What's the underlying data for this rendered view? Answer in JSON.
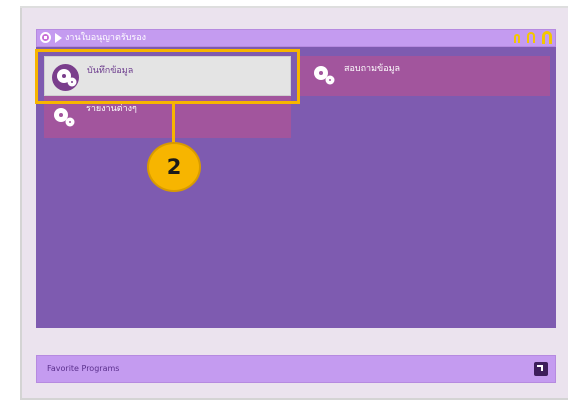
{
  "header": {
    "title": "งานใบอนุญาตรับรอง",
    "home_icon": "home-icon",
    "breadcrumb_icon": "triangle-right-icon",
    "window_buttons": [
      "minimize-icon",
      "restore-icon",
      "close-icon"
    ],
    "accent_color": "#c49bf0"
  },
  "menu": {
    "tiles": [
      {
        "label": "บันทึกข้อมูล",
        "icon": "gears-icon"
      },
      {
        "label": "สอบถามข้อมูล",
        "icon": "gears-icon"
      },
      {
        "label": "รายงานต่างๆ",
        "icon": "gears-icon"
      }
    ],
    "panel_color": "#7e5bb0",
    "tile_color": "#a2559d"
  },
  "annotation": {
    "number": "2",
    "color": "#f7b500"
  },
  "favorites": {
    "label": "Favorite Programs",
    "icon": "external-link-icon"
  }
}
